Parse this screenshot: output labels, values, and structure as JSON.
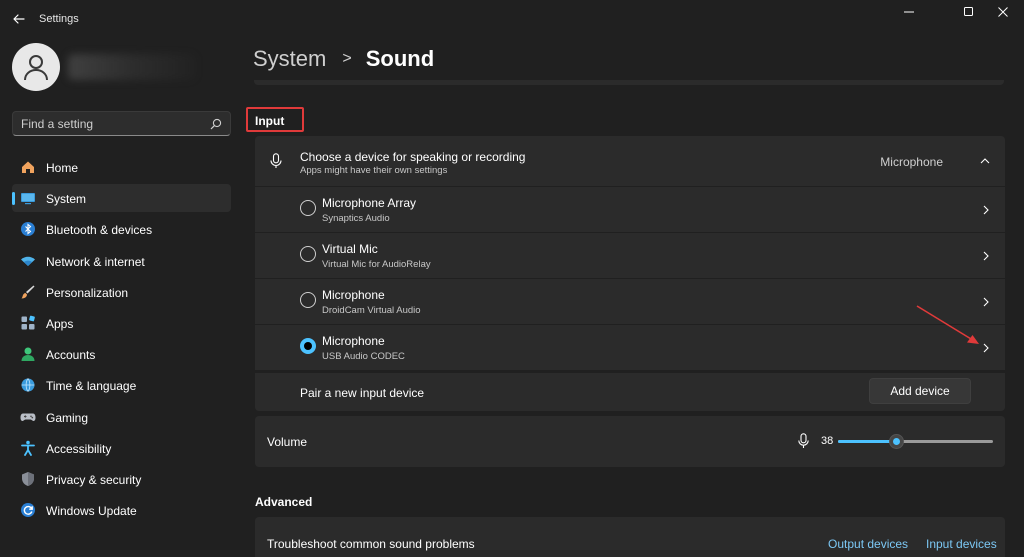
{
  "window": {
    "title": "Settings",
    "controls": [
      "minimize-icon",
      "maximize-icon",
      "close-icon"
    ]
  },
  "sidebar": {
    "search_placeholder": "Find a setting",
    "items": [
      {
        "label": "Home",
        "icon": "home-icon"
      },
      {
        "label": "System",
        "icon": "system-icon",
        "active": true
      },
      {
        "label": "Bluetooth & devices",
        "icon": "bluetooth-icon"
      },
      {
        "label": "Network & internet",
        "icon": "wifi-icon"
      },
      {
        "label": "Personalization",
        "icon": "brush-icon"
      },
      {
        "label": "Apps",
        "icon": "apps-icon"
      },
      {
        "label": "Accounts",
        "icon": "accounts-icon"
      },
      {
        "label": "Time & language",
        "icon": "globe-icon"
      },
      {
        "label": "Gaming",
        "icon": "gamepad-icon"
      },
      {
        "label": "Accessibility",
        "icon": "accessibility-icon"
      },
      {
        "label": "Privacy & security",
        "icon": "shield-icon"
      },
      {
        "label": "Windows Update",
        "icon": "update-icon"
      }
    ]
  },
  "header": {
    "breadcrumb_parent": "System",
    "breadcrumb_separator": ">",
    "title": "Sound"
  },
  "input": {
    "heading": "Input",
    "choose_title": "Choose a device for speaking or recording",
    "choose_subtitle": "Apps might have their own settings",
    "selected_device": "Microphone",
    "devices": [
      {
        "name": "Microphone Array",
        "subtitle": "Synaptics Audio",
        "selected": false
      },
      {
        "name": "Virtual Mic",
        "subtitle": "Virtual Mic for AudioRelay",
        "selected": false
      },
      {
        "name": "Microphone",
        "subtitle": "DroidCam Virtual Audio",
        "selected": false
      },
      {
        "name": "Microphone",
        "subtitle": "USB Audio CODEC",
        "selected": true
      }
    ],
    "pair_label": "Pair a new input device",
    "add_button": "Add device",
    "volume_label": "Volume",
    "volume_value": "38",
    "volume_level": 38
  },
  "advanced": {
    "heading": "Advanced",
    "troubleshoot_label": "Troubleshoot common sound problems",
    "output_link": "Output devices",
    "input_link": "Input devices"
  },
  "colors": {
    "accent": "#4cc2ff",
    "highlight_box": "#e03a3a",
    "annotation_arrow": "#e03a3a"
  }
}
